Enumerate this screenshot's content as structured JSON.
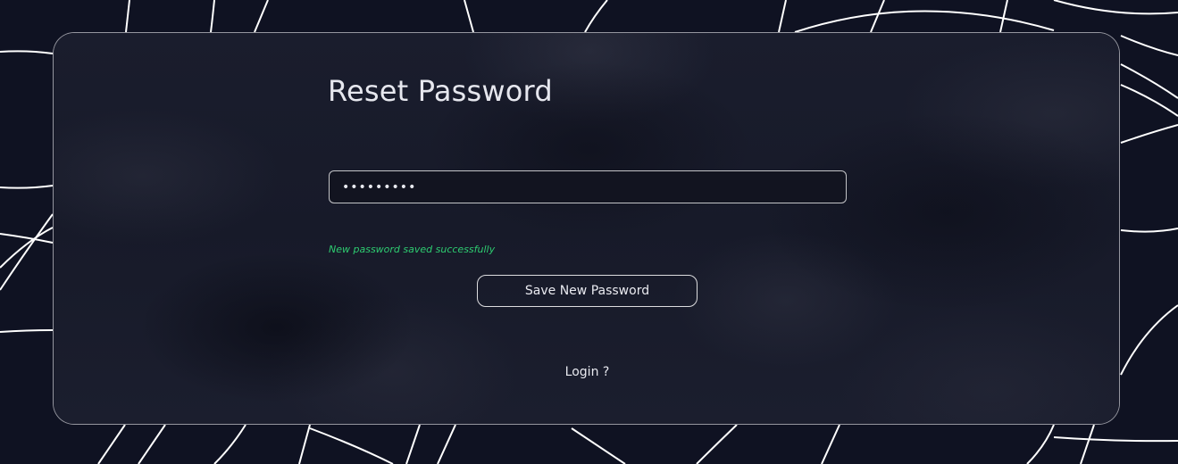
{
  "form": {
    "title": "Reset Password",
    "password_value": "•••••••••",
    "success_message": "New password saved successfully",
    "save_button_label": "Save New Password",
    "login_link_label": "Login ?"
  },
  "colors": {
    "background": "#0f1222",
    "card": "#15182a",
    "success": "#2ecc71",
    "text": "#e9eaf0"
  }
}
